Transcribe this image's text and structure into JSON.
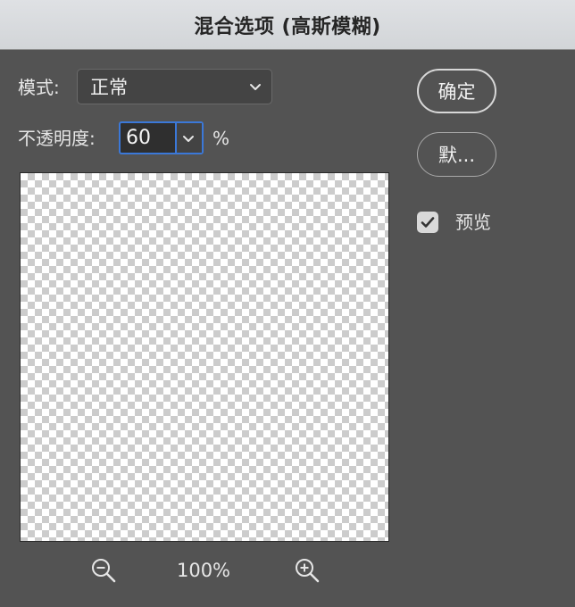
{
  "window": {
    "title": "混合选项 (高斯模糊)"
  },
  "mode": {
    "label": "模式:",
    "value": "正常"
  },
  "opacity": {
    "label": "不透明度:",
    "value": "60",
    "unit": "%"
  },
  "zoom": {
    "level": "100%",
    "zoom_out_icon": "zoom-out-icon",
    "zoom_in_icon": "zoom-in-icon"
  },
  "buttons": {
    "ok_label": "确定",
    "default_label": "默..."
  },
  "preview_toggle": {
    "label": "预览",
    "checked": true
  },
  "colors": {
    "dialog_bg": "#535353",
    "titlebar_bg": "#d2d5d8",
    "focus_ring": "#3b78d8"
  }
}
